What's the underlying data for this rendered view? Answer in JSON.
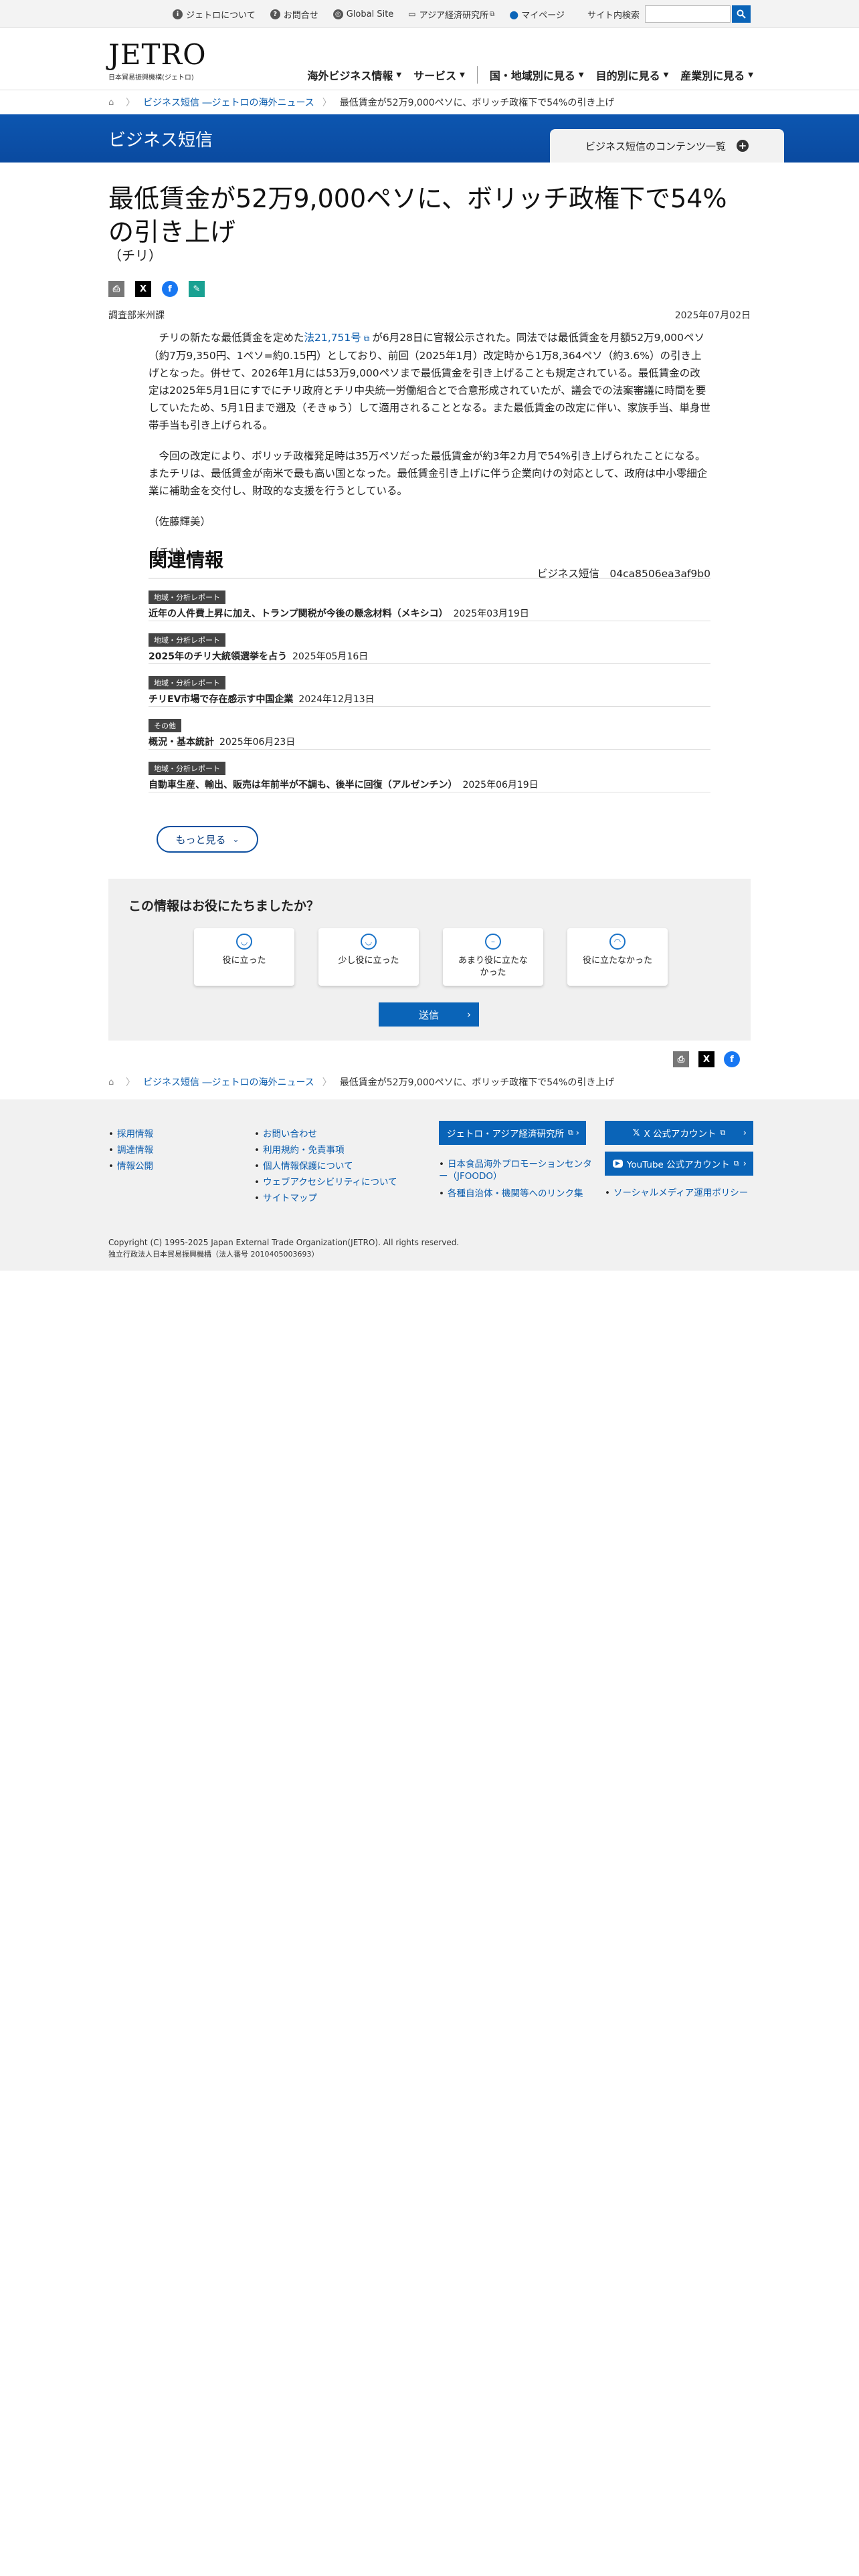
{
  "utility": {
    "about": "ジェトロについて",
    "contact": "お問合せ",
    "global": "Global Site",
    "ide": "アジア経済研究所",
    "mypage": "マイページ",
    "search_label": "サイト内検索"
  },
  "logo": {
    "main": "JETRO",
    "sub": "日本貿易振興機構(ジェトロ)"
  },
  "gnav": [
    "海外ビジネス情報",
    "サービス",
    "国・地域別に見る",
    "目的別に見る",
    "産業別に見る"
  ],
  "breadcrumb": {
    "section": "ビジネス短信 ―ジェトロの海外ニュース",
    "current": "最低賃金が52万9,000ペソに、ボリッチ政権下で54%の引き上げ"
  },
  "band": {
    "title": "ビジネス短信",
    "tab": "ビジネス短信のコンテンツ一覧"
  },
  "article": {
    "title": "最低賃金が52万9,000ペソに、ボリッチ政権下で54%の引き上げ",
    "country": "（チリ）",
    "dept": "調査部米州課",
    "date": "2025年07月02日",
    "p1_a": "チリの新たな最低賃金を定めた",
    "p1_link": "法21,751号",
    "p1_b": "が6月28日に官報公示された。同法では最低賃金を月額52万9,000ペソ（約7万9,350円、1ペソ=約0.15円）としており、前回（2025年1月）改定時から1万8,364ペソ（約3.6%）の引き上げとなった。併せて、2026年1月には53万9,000ペソまで最低賃金を引き上げることも規定されている。最低賃金の改定は2025年5月1日にすでにチリ政府とチリ中央統一労働組合とで合意形成されていたが、議会での法案審議に時間を要していたため、5月1日まで遡及（そきゅう）して適用されることとなる。また最低賃金の改定に伴い、家族手当、単身世帯手当も引き上げられる。",
    "p2": "今回の改定により、ボリッチ政権発足時は35万ペソだった最低賃金が約3年2カ月で54%引き上げられたことになる。またチリは、最低賃金が南米で最も高い国となった。最低賃金引き上げに伴う企業向けの対応として、政府は中小零細企業に補助金を交付し、財政的な支援を行うとしている。",
    "author": "（佐藤輝美）",
    "tag": "（チリ）",
    "code": "ビジネス短信　04ca8506ea3af9b0"
  },
  "related": {
    "heading": "関連情報",
    "items": [
      {
        "badge": "地域・分析レポート",
        "title": "近年の人件費上昇に加え、トランプ関税が今後の懸念材料（メキシコ）",
        "date": "2025年03月19日"
      },
      {
        "badge": "地域・分析レポート",
        "title": "2025年のチリ大統領選挙を占う",
        "date": "2025年05月16日"
      },
      {
        "badge": "地域・分析レポート",
        "title": "チリEV市場で存在感示す中国企業",
        "date": "2024年12月13日"
      },
      {
        "badge": "その他",
        "title": "概況・基本統計",
        "date": "2025年06月23日"
      },
      {
        "badge": "地域・分析レポート",
        "title": "自動車生産、輸出、販売は年前半が不調も、後半に回復（アルゼンチン）",
        "date": "2025年06月19日"
      }
    ],
    "more": "もっと見る"
  },
  "survey": {
    "question": "この情報はお役にたちましたか？",
    "options": [
      "役に立った",
      "少し役に立った",
      "あまり役に立たなかった",
      "役に立たなかった"
    ],
    "submit": "送信"
  },
  "footer": {
    "col1": [
      "採用情報",
      "調達情報",
      "情報公開"
    ],
    "col2": [
      "お問い合わせ",
      "利用規約・免責事項",
      "個人情報保護について",
      "ウェブアクセシビリティについて",
      "サイトマップ"
    ],
    "ide_btn": "ジェトロ・アジア経済研究所",
    "col3": [
      "日本食品海外プロモーションセンター（JFOODO）",
      "各種自治体・機関等へのリンク集"
    ],
    "x_btn": "X 公式アカウント",
    "yt_btn": "YouTube 公式アカウント",
    "col4": [
      "ソーシャルメディア運用ポリシー"
    ],
    "copyright": "Copyright (C) 1995-2025 Japan External Trade Organization(JETRO). All rights reserved.",
    "corp": "独立行政法人日本貿易振興機構（法人番号 2010405003693）"
  },
  "colors": {
    "brand_blue": "#0a64b8",
    "band_blue": "#0d56b0"
  }
}
